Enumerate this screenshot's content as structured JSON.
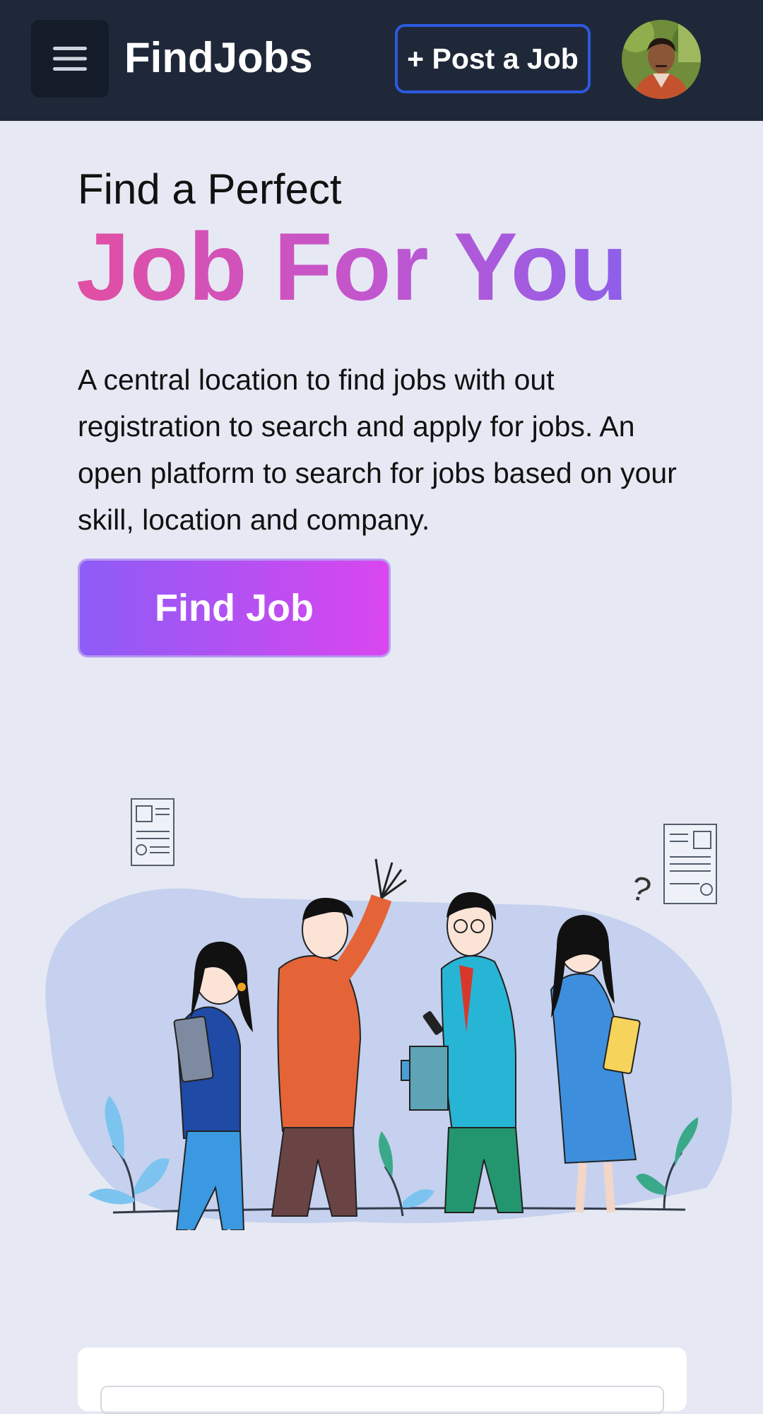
{
  "app": {
    "brand": "FindJobs"
  },
  "header": {
    "menu_icon": "hamburger-menu-icon",
    "post_job_label": "+ Post a Job",
    "avatar_icon": "user-avatar"
  },
  "hero": {
    "subtitle": "Find a Perfect",
    "title": "Job For You",
    "description": "A central location to find jobs with out registration to search and apply for jobs. An open platform to search for jobs based on your skill, location and company.",
    "cta_label": "Find Job",
    "title_gradient": [
      "#e24fa3",
      "#8e5fea"
    ],
    "cta_gradient": [
      "#8d5cf6",
      "#d946ef"
    ]
  },
  "colors": {
    "topbar": "#1f2839",
    "accent_border": "#2c59e0",
    "page_background": "#e6e9f3"
  }
}
